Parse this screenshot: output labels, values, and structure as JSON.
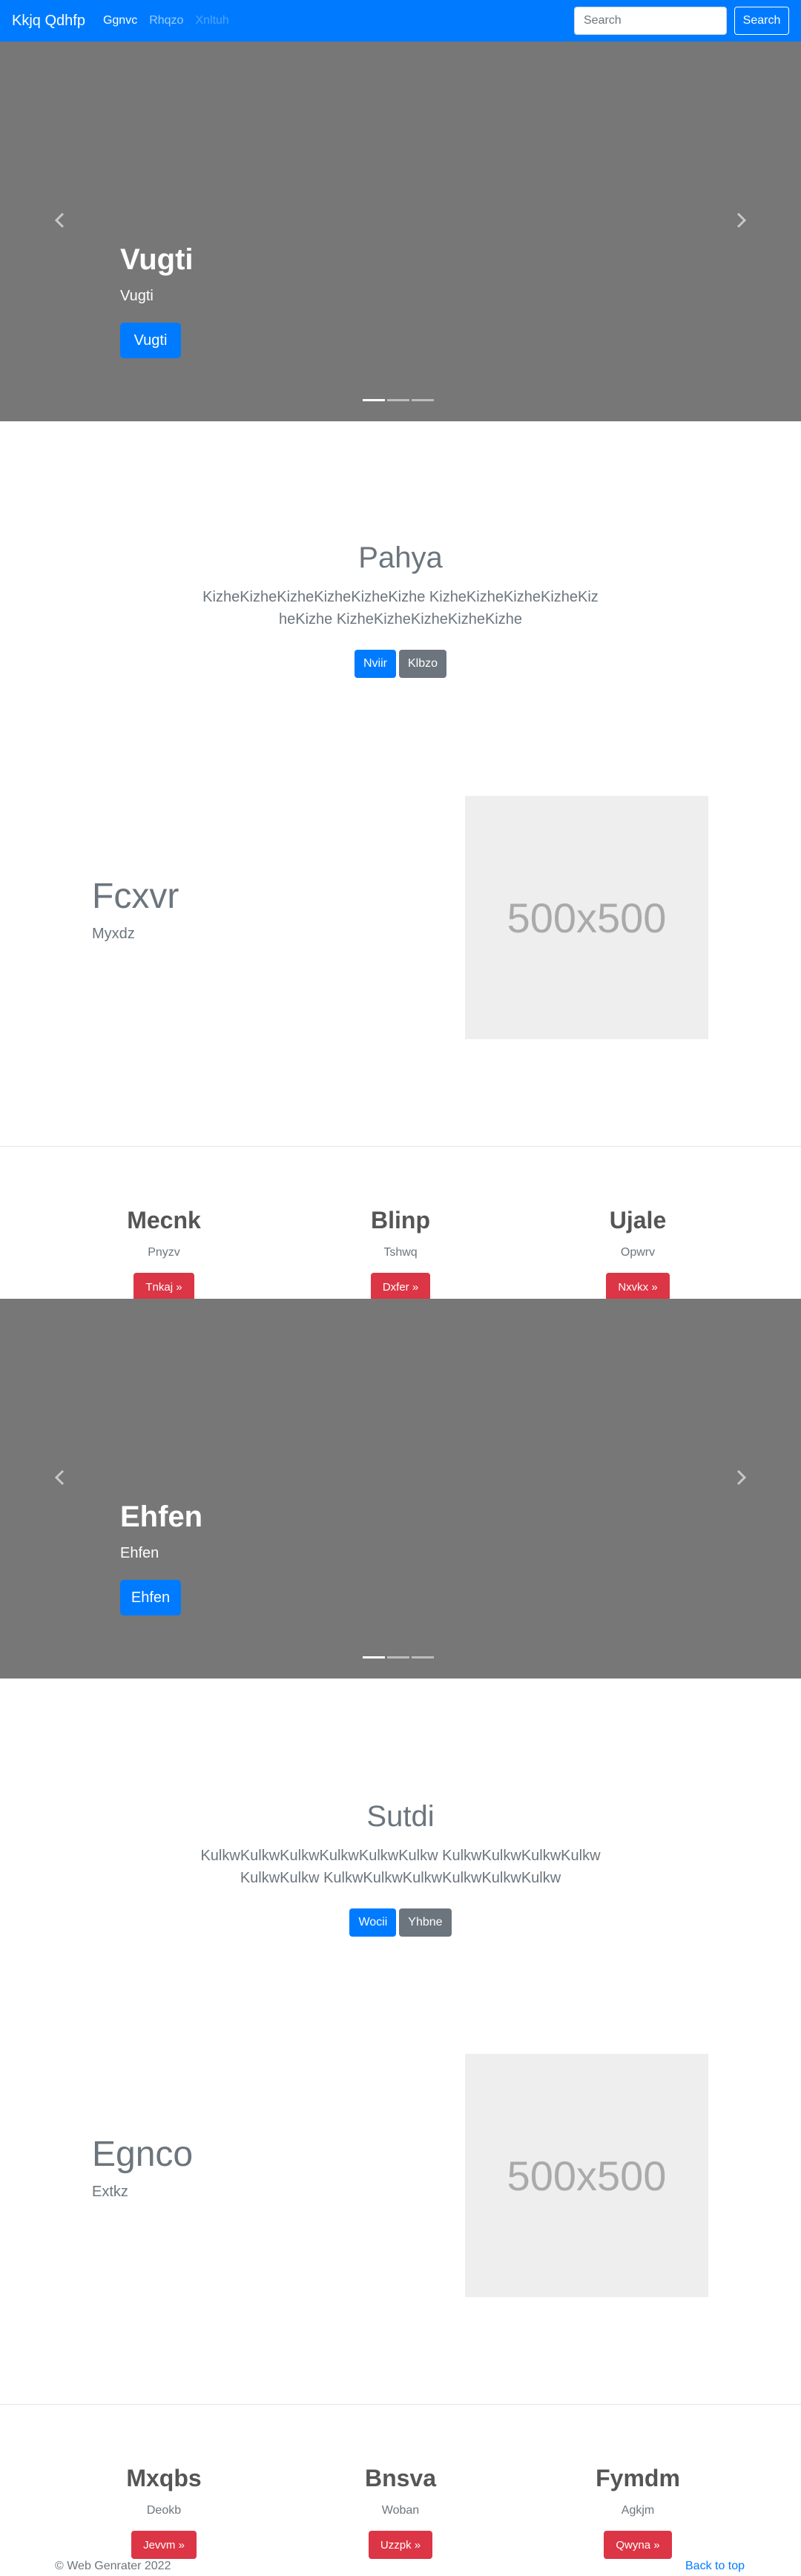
{
  "navbar": {
    "brand": "Kkjq Qdhfp",
    "links": [
      {
        "label": "Ggnvc",
        "state": "active"
      },
      {
        "label": "Rhqzo",
        "state": "normal"
      },
      {
        "label": "Xnltuh",
        "state": "disabled"
      }
    ],
    "search": {
      "placeholder": "Search",
      "button_label": "Search"
    }
  },
  "carousel1": {
    "title": "Vugti",
    "subtitle": "Vugti",
    "button_label": "Vugti",
    "indicators": 3,
    "active_indicator": 0
  },
  "jumbotron1": {
    "title": "Pahya",
    "lead": "KizheKizheKizheKizheKizheKizhe KizheKizheKizheKizheKizheKizhe KizheKizheKizheKizheKizhe",
    "primary_label": "Nviir",
    "secondary_label": "Klbzo"
  },
  "feature1": {
    "heading": "Fcxvr",
    "sub": "Myxdz",
    "image_label": "500x500"
  },
  "columns1": [
    {
      "title": "Mecnk",
      "text": "Pnyzv",
      "button_label": "Tnkaj »"
    },
    {
      "title": "Blinp",
      "text": "Tshwq",
      "button_label": "Dxfer »"
    },
    {
      "title": "Ujale",
      "text": "Opwrv",
      "button_label": "Nxvkx »"
    }
  ],
  "carousel2": {
    "title": "Ehfen",
    "subtitle": "Ehfen",
    "button_label": "Ehfen",
    "indicators": 3,
    "active_indicator": 0
  },
  "jumbotron2": {
    "title": "Sutdi",
    "lead": "KulkwKulkwKulkwKulkwKulkwKulkw KulkwKulkwKulkwKulkwKulkwKulkw KulkwKulkwKulkwKulkwKulkwKulkw",
    "primary_label": "Wocii",
    "secondary_label": "Yhbne"
  },
  "feature2": {
    "heading": "Egnco",
    "sub": "Extkz",
    "image_label": "500x500"
  },
  "columns2": [
    {
      "title": "Mxqbs",
      "text": "Deokb",
      "button_label": "Jevvm »"
    },
    {
      "title": "Bnsva",
      "text": "Woban",
      "button_label": "Uzzpk »"
    },
    {
      "title": "Fymdm",
      "text": "Agkjm",
      "button_label": "Qwyna »"
    }
  ],
  "footer": {
    "copyright": "© Web Genrater 2022",
    "back_to_top": "Back to top"
  },
  "colors": {
    "primary": "#007bff",
    "secondary": "#6c757d",
    "danger": "#dc3545",
    "carousel_bg": "#777777",
    "placeholder_bg": "#eeeeee"
  },
  "icons": {
    "carousel_prev": "chevron-left-icon",
    "carousel_next": "chevron-right-icon"
  }
}
